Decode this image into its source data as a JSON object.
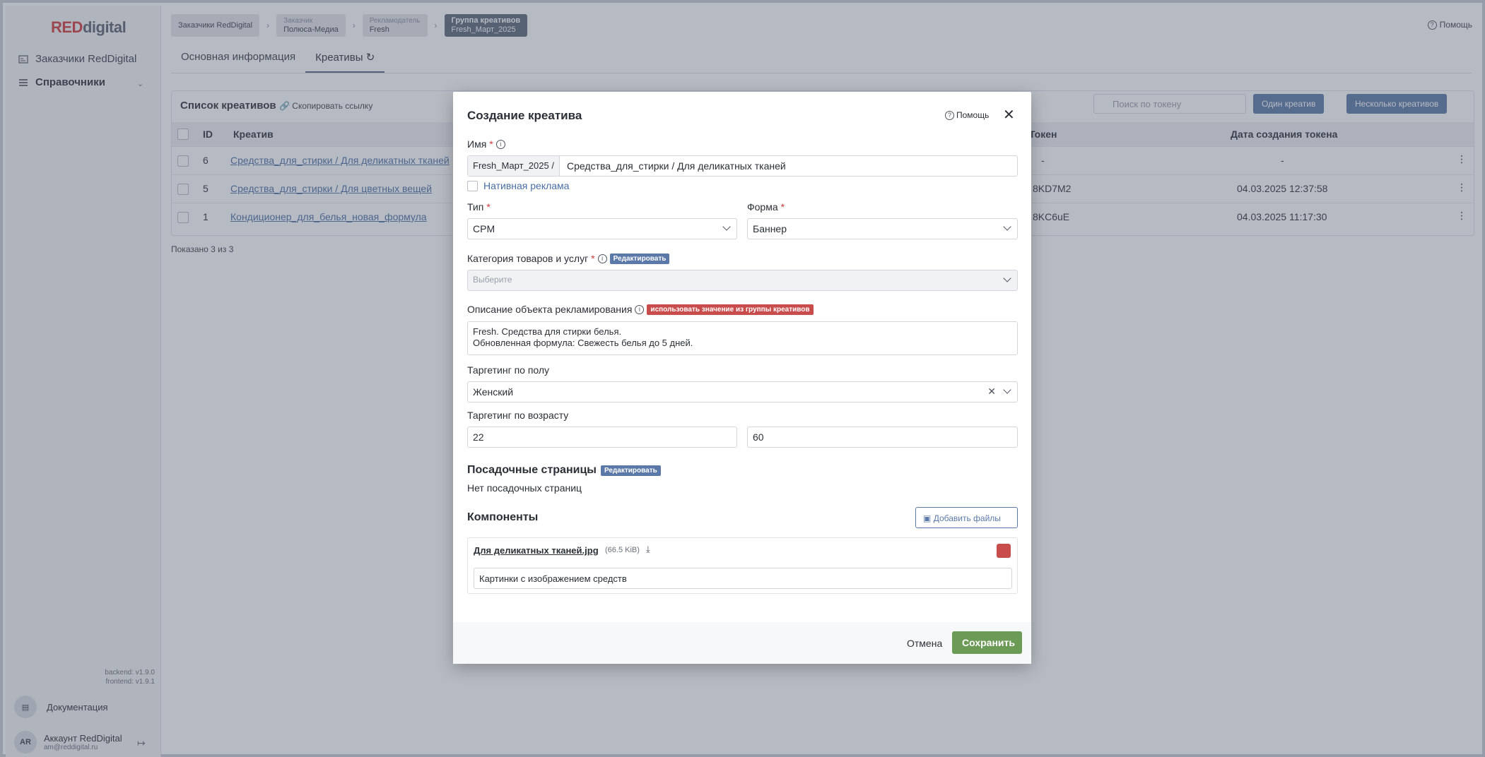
{
  "logo": {
    "red": "RED",
    "digital": "digital"
  },
  "sidebar": {
    "items": [
      {
        "label": "Заказчики RedDigital"
      },
      {
        "label": "Справочники"
      }
    ],
    "versions": {
      "backend": "backend: v1.9.0",
      "frontend": "frontend: v1.9.1"
    },
    "docs": "Документация",
    "account": {
      "initials": "AR",
      "name": "Аккаунт RedDigital",
      "email": "am@reddigital.ru"
    }
  },
  "breadcrumbs": [
    {
      "label": "",
      "value": "Заказчики RedDigital"
    },
    {
      "label": "Заказчик",
      "value": "Полюса-Медиа"
    },
    {
      "label": "Рекламодатель",
      "value": "Fresh"
    },
    {
      "label": "Группа креативов",
      "value": "Fresh_Март_2025"
    }
  ],
  "help_top": "Помощь",
  "tabs": [
    {
      "label": "Основная информация"
    },
    {
      "label": "Креативы"
    }
  ],
  "list": {
    "title": "Список креативов",
    "copy_link": "Скопировать ссылку",
    "search_placeholder": "Поиск по токену",
    "btn_single": "Один креатив",
    "btn_multiple": "Несколько креативов",
    "columns": {
      "id": "ID",
      "creative": "Креатив",
      "token": "Токен",
      "token_date": "Дата создания токена"
    },
    "rows": [
      {
        "id": "6",
        "name": "Средства_для_стирки / Для деликатных тканей",
        "token": "-",
        "date": "-"
      },
      {
        "id": "5",
        "name": "Средства_для_стирки / Для цветных вещей",
        "token": "8KD7M2",
        "date": "04.03.2025 12:37:58"
      },
      {
        "id": "1",
        "name": "Кондиционер_для_белья_новая_формула",
        "token": "8KC6uE",
        "date": "04.03.2025 11:17:30"
      }
    ],
    "shown": "Показано 3 из 3"
  },
  "modal": {
    "title": "Создание креатива",
    "help": "Помощь",
    "name_label": "Имя",
    "name_prefix": "Fresh_Март_2025 /",
    "name_value": "Средства_для_стирки / Для деликатных тканей",
    "native_label": "Нативная реклама",
    "type_label": "Тип",
    "type_value": "CPM",
    "form_label": "Форма",
    "form_value": "Баннер",
    "category_label": "Категория товаров и услуг",
    "edit_badge": "Редактировать",
    "category_placeholder": "Выберите",
    "desc_label": "Описание объекта рекламирования",
    "use_group_badge": "использовать значение из группы креативов",
    "desc_line1": "Fresh. Средства для стирки белья.",
    "desc_line2": "Обновленная формула: Свежесть белья до 5 дней.",
    "gender_label": "Таргетинг по полу",
    "gender_value": "Женский",
    "age_label": "Таргетинг по возрасту",
    "age_from": "22",
    "age_to": "60",
    "landing_title": "Посадочные страницы",
    "landing_empty": "Нет посадочных страниц",
    "components_title": "Компоненты",
    "add_files": "Добавить файлы",
    "file_name": "Для деликатных тканей.jpg",
    "file_size": "(66.5 KiB)",
    "file_desc": "Картинки с изображением средств",
    "cancel": "Отмена",
    "save": "Сохранить"
  }
}
